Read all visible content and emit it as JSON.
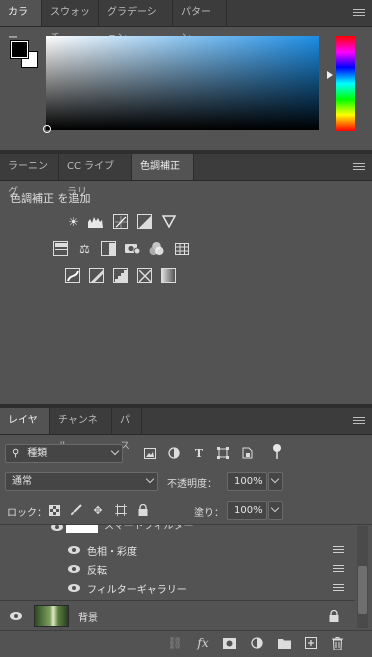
{
  "color_panel": {
    "tabs": [
      "カラー",
      "スウォッチ",
      "グラデーション",
      "パターン"
    ],
    "active_tab": 0,
    "foreground_color": "#000000",
    "background_color": "#ffffff",
    "field_hue_color": "#1c8ee6"
  },
  "adjust_panel": {
    "tabs": [
      "ラーニング",
      "CC ライブラリ",
      "色調補正"
    ],
    "active_tab": 2,
    "title": "色調補正 を追加",
    "rows": [
      [
        "brightness-contrast-icon",
        "levels-icon",
        "curves-icon",
        "exposure-icon",
        "vibrance-icon"
      ],
      [
        "hue-saturation-icon",
        "color-balance-icon",
        "black-white-icon",
        "photo-filter-icon",
        "channel-mixer-icon",
        "color-lookup-icon"
      ],
      [
        "invert-icon",
        "posterize-icon",
        "threshold-icon",
        "selective-color-icon",
        "gradient-map-icon"
      ]
    ]
  },
  "layers_panel": {
    "tabs": [
      "レイヤー",
      "チャンネル",
      "パス"
    ],
    "active_tab": 0,
    "filter_kind": "種類",
    "blend_mode": "通常",
    "opacity_label": "不透明度：",
    "opacity_value": "100%",
    "lock_label": "ロック：",
    "fill_label": "塗り：",
    "fill_value": "100%",
    "partial_layer_name": "スマートフィルター",
    "filters": [
      "色相・彩度",
      "反転",
      "フィルターギャラリー"
    ],
    "bottom_layer": "背景"
  }
}
